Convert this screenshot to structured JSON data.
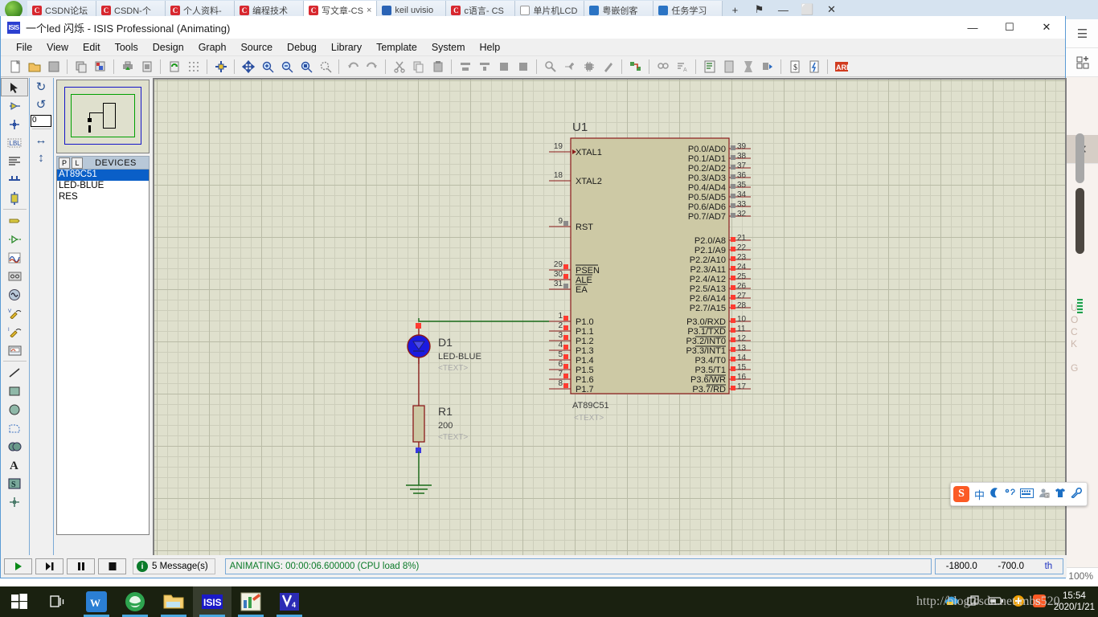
{
  "browser": {
    "tabs": [
      {
        "label": "CSDN论坛",
        "icon": "csdn-favicon",
        "active": false
      },
      {
        "label": "CSDN-个",
        "icon": "csdn-favicon",
        "active": false
      },
      {
        "label": "个人资料-",
        "icon": "csdn-favicon",
        "active": false
      },
      {
        "label": "编程技术",
        "icon": "csdn-favicon",
        "active": false
      },
      {
        "label": "写文章-CS",
        "icon": "csdn-favicon",
        "active": true,
        "close": "×"
      },
      {
        "label": "keil uvisio",
        "icon": "keil-favicon",
        "active": false
      },
      {
        "label": "c语言- CS",
        "icon": "csdn-favicon",
        "active": false
      },
      {
        "label": "单片机LCD",
        "icon": "document-favicon",
        "active": false
      },
      {
        "label": "粤嵌创客",
        "icon": "blue-favicon",
        "active": false
      },
      {
        "label": "任务学习",
        "icon": "blue-favicon",
        "active": false
      }
    ],
    "new_tab": "+",
    "window_buttons": [
      "⚑",
      "—",
      "⬜",
      "✕"
    ],
    "rail": {
      "menu": "☰",
      "apps": "apps-icon",
      "close": "✕",
      "vertical_text": "UOCKG"
    },
    "zoom_level": "100%"
  },
  "isis": {
    "title": "一个led 闪烁 - ISIS Professional (Animating)",
    "app_icon_label": "ISIS",
    "window_buttons": {
      "minimize": "—",
      "maximize": "☐",
      "close": "✕"
    },
    "menu": [
      "File",
      "View",
      "Edit",
      "Tools",
      "Design",
      "Graph",
      "Source",
      "Debug",
      "Library",
      "Template",
      "System",
      "Help"
    ],
    "toolbar_icons": [
      "new-file-icon",
      "open-file-icon",
      "save-icon",
      "import-section-icon",
      "export-section-icon",
      "print-icon",
      "print-area-icon",
      "refresh-icon",
      "grid-toggle-icon",
      "origin-icon",
      "pan-icon",
      "zoom-in-icon",
      "zoom-out-icon",
      "zoom-area-icon",
      "zoom-sheet-icon",
      "undo-icon",
      "redo-icon",
      "cut-icon",
      "copy-icon",
      "paste-icon",
      "block-copy-icon",
      "block-move-icon",
      "block-rotate-icon",
      "block-delete-icon",
      "pick-device-icon",
      "make-device-icon",
      "package-tool-icon",
      "decompose-icon",
      "wire-autorouter-icon",
      "search-tag-icon",
      "property-assign-icon",
      "design-explorer-icon",
      "new-sheet-icon",
      "remove-sheet-icon",
      "exit-sheet-icon",
      "bill-of-materials-icon",
      "electrical-rule-check-icon",
      "netlist-ares-icon"
    ],
    "left_tools": [
      "selection-mode-icon",
      "component-mode-icon",
      "junction-dot-icon",
      "wire-label-icon",
      "text-script-icon",
      "buses-icon",
      "subcircuit-icon",
      "terminals-icon",
      "device-pins-icon",
      "graph-mode-icon",
      "tape-recorder-icon",
      "generator-mode-icon",
      "voltage-probe-icon",
      "current-probe-icon",
      "virtual-instrument-icon",
      "2d-line-icon",
      "2d-box-icon",
      "2d-circle-icon",
      "2d-arc-icon",
      "2d-closed-path-icon",
      "2d-text-icon",
      "2d-symbol-icon",
      "2d-markers-icon"
    ],
    "rotation": {
      "rotate-cw": "↻",
      "rotate-ccw": "↺",
      "angle_value": "0",
      "mirror-horizontal": "↔",
      "mirror-vertical": "↕"
    },
    "picker": {
      "header_buttons": [
        "P",
        "L"
      ],
      "header_label": "DEVICES",
      "devices": [
        "AT89C51",
        "LED-BLUE",
        "RES"
      ],
      "selected_device": "AT89C51"
    },
    "statusbar": {
      "animation_buttons": [
        "play-icon",
        "step-icon",
        "pause-icon",
        "stop-icon"
      ],
      "messages": "5 Message(s)",
      "messages_icon": "info-icon",
      "animating_status": "ANIMATING: 00:00:06.600000 (CPU load 8%)",
      "coord_x": "-1800.0",
      "coord_y": "-700.0",
      "coord_unit": "th"
    }
  },
  "schematic": {
    "components": {
      "u1": {
        "ref": "U1",
        "part": "AT89C51",
        "text_placeholder": "<TEXT>",
        "left_pins": [
          {
            "num": "19",
            "label": "XTAL1",
            "state": "none"
          },
          {
            "num": "18",
            "label": "XTAL2",
            "state": "none"
          },
          {
            "num": "9",
            "label": "RST",
            "state": "grey"
          },
          {
            "num": "29",
            "label": "PSEN",
            "state": "red",
            "overline": true
          },
          {
            "num": "30",
            "label": "ALE",
            "state": "red",
            "overline": true
          },
          {
            "num": "31",
            "label": "EA",
            "state": "grey",
            "overline": true
          },
          {
            "num": "1",
            "label": "P1.0",
            "state": "red"
          },
          {
            "num": "2",
            "label": "P1.1",
            "state": "red"
          },
          {
            "num": "3",
            "label": "P1.2",
            "state": "red"
          },
          {
            "num": "4",
            "label": "P1.3",
            "state": "red"
          },
          {
            "num": "5",
            "label": "P1.4",
            "state": "red"
          },
          {
            "num": "6",
            "label": "P1.5",
            "state": "red"
          },
          {
            "num": "7",
            "label": "P1.6",
            "state": "red"
          },
          {
            "num": "8",
            "label": "P1.7",
            "state": "red"
          }
        ],
        "right_pins": [
          {
            "num": "39",
            "label": "P0.0/AD0",
            "state": "grey"
          },
          {
            "num": "38",
            "label": "P0.1/AD1",
            "state": "grey"
          },
          {
            "num": "37",
            "label": "P0.2/AD2",
            "state": "grey"
          },
          {
            "num": "36",
            "label": "P0.3/AD3",
            "state": "grey"
          },
          {
            "num": "35",
            "label": "P0.4/AD4",
            "state": "grey"
          },
          {
            "num": "34",
            "label": "P0.5/AD5",
            "state": "grey"
          },
          {
            "num": "33",
            "label": "P0.6/AD6",
            "state": "grey"
          },
          {
            "num": "32",
            "label": "P0.7/AD7",
            "state": "grey"
          },
          {
            "num": "21",
            "label": "P2.0/A8",
            "state": "red"
          },
          {
            "num": "22",
            "label": "P2.1/A9",
            "state": "red"
          },
          {
            "num": "23",
            "label": "P2.2/A10",
            "state": "red"
          },
          {
            "num": "24",
            "label": "P2.3/A11",
            "state": "red"
          },
          {
            "num": "25",
            "label": "P2.4/A12",
            "state": "red"
          },
          {
            "num": "26",
            "label": "P2.5/A13",
            "state": "red"
          },
          {
            "num": "27",
            "label": "P2.6/A14",
            "state": "red"
          },
          {
            "num": "28",
            "label": "P2.7/A15",
            "state": "red"
          },
          {
            "num": "10",
            "label": "P3.0/RXD",
            "state": "red"
          },
          {
            "num": "11",
            "label": "P3.1/TXD",
            "state": "red"
          },
          {
            "num": "12",
            "label": "P3.2/INT0",
            "state": "red"
          },
          {
            "num": "13",
            "label": "P3.3/INT1",
            "state": "red"
          },
          {
            "num": "14",
            "label": "P3.4/T0",
            "state": "red"
          },
          {
            "num": "15",
            "label": "P3.5/T1",
            "state": "red"
          },
          {
            "num": "16",
            "label": "P3.6/WR",
            "state": "red"
          },
          {
            "num": "17",
            "label": "P3.7/RD",
            "state": "red"
          }
        ]
      },
      "d1": {
        "ref": "D1",
        "part": "LED-BLUE",
        "text_placeholder": "<TEXT>",
        "lit_color": "#1a1ae0",
        "pin_state": "red"
      },
      "r1": {
        "ref": "R1",
        "value": "200",
        "text_placeholder": "<TEXT>",
        "pin_state": "blue"
      },
      "ground": {
        "label": "GND"
      }
    },
    "colors": {
      "sheet_bg": "#dfe0cd",
      "grid_minor": "#cdcebb",
      "grid_major": "#b9bba6",
      "body_fill": "#cdc9a5",
      "body_stroke": "#8b1a1a",
      "pin_wire": "#8b1a1a",
      "wire_green": "#1a6b1a",
      "text_grey": "#a9a9a9"
    }
  },
  "taskbar": {
    "start": "start-icon",
    "task_view": "task-view-icon",
    "apps": [
      "wps-icon",
      "ie-browser-icon",
      "file-explorer-icon",
      "isis-proteus-icon",
      "notes-icon",
      "keil-icon"
    ],
    "active_app": "isis-proteus-icon",
    "tray": [
      "onedrive-icon",
      "duplicate-icon",
      "battery-icon",
      "update-icon",
      "sogou-icon"
    ],
    "clock_time": "15:54",
    "clock_date": "2020/1/21",
    "watermark": "http://blog.csdn.net/mbs520"
  },
  "ime": {
    "logo": "S",
    "items": [
      "中",
      "moon-icon",
      "punctuation-icon",
      "keyboard-icon",
      "user-icon",
      "skin-icon",
      "tools-icon"
    ]
  }
}
